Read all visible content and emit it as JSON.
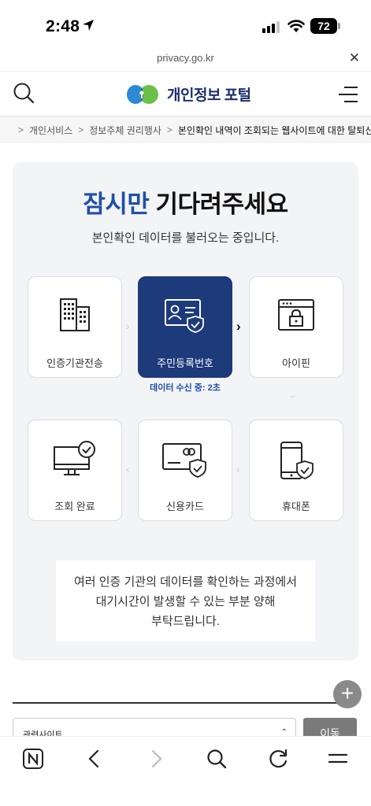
{
  "status_bar": {
    "time": "2:48",
    "battery": "72"
  },
  "url_bar": {
    "domain": "privacy.go.kr"
  },
  "header": {
    "logo_text": "개인정보 포털"
  },
  "breadcrumb": {
    "items": [
      "개인서비스",
      "정보주체 권리행사"
    ],
    "current": "본인확인 내역이 조회되는 웹사이트에 대한 탈퇴신청"
  },
  "main": {
    "title_accent": "잠시만",
    "title_rest": "기다려주세요",
    "subtitle": "본인확인 데이터를 불러오는 중입니다.",
    "steps": [
      {
        "label": "인증기관전송",
        "icon": "building-icon",
        "active": false
      },
      {
        "label": "주민등록번호",
        "icon": "id-card-shield-icon",
        "active": true
      },
      {
        "label": "아이핀",
        "icon": "browser-lock-icon",
        "active": false
      },
      {
        "label": "조회 완료",
        "icon": "monitor-check-icon",
        "active": false
      },
      {
        "label": "신용카드",
        "icon": "credit-card-shield-icon",
        "active": false
      },
      {
        "label": "휴대폰",
        "icon": "phone-shield-icon",
        "active": false
      }
    ],
    "status_text": "데이터 수신 중: 2초",
    "notice_lines": [
      "여러 인증 기관의 데이터를 확인하는 과정에서",
      "대기시간이 발생할 수 있는 부분 양해",
      "부탁드립니다."
    ]
  },
  "footer": {
    "related_site_label": "관련사이트",
    "go_label": "이동"
  },
  "colors": {
    "accent": "#1f4fa8",
    "active_step": "#1d3a7a",
    "card_bg": "#f3f4f6"
  }
}
